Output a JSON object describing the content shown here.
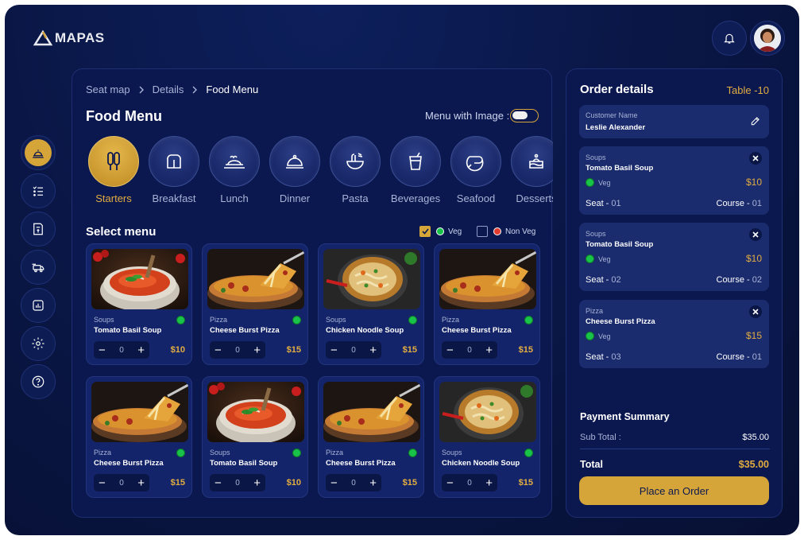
{
  "app": {
    "logo_text": "MAPAS"
  },
  "colors": {
    "accent": "#d6a53a",
    "bg": "#0a1747",
    "veg": "#19c248",
    "non_veg": "#e23b2f"
  },
  "header": {
    "bell_icon": "bell-icon",
    "avatar": "user-avatar"
  },
  "sidebar": {
    "items": [
      "food-bell-icon",
      "checklist-icon",
      "bill-icon",
      "delivery-icon",
      "report-icon",
      "gear-icon",
      "help-icon"
    ]
  },
  "breadcrumb": {
    "items": [
      "Seat map",
      "Details"
    ],
    "current": "Food Menu"
  },
  "menu": {
    "title": "Food Menu",
    "toggle_label": "Menu with Image :",
    "categories": [
      "Starters",
      "Breakfast",
      "Lunch",
      "Dinner",
      "Pasta",
      "Beverages",
      "Seafood",
      "Desserts"
    ],
    "select_title": "Select menu",
    "filter_veg": "Veg",
    "filter_nonveg": "Non Veg",
    "cards": [
      {
        "category": "Soups",
        "name": "Tomato Basil Soup",
        "qty": "0",
        "price": "$10",
        "img": "soup"
      },
      {
        "category": "Pizza",
        "name": "Cheese Burst Pizza",
        "qty": "0",
        "price": "$15",
        "img": "pizza"
      },
      {
        "category": "Soups",
        "name": "Chicken Noodle Soup",
        "qty": "0",
        "price": "$15",
        "img": "noodle"
      },
      {
        "category": "Pizza",
        "name": "Cheese Burst Pizza",
        "qty": "0",
        "price": "$15",
        "img": "pizza"
      },
      {
        "category": "Pizza",
        "name": "Cheese Burst Pizza",
        "qty": "0",
        "price": "$15",
        "img": "pizza"
      },
      {
        "category": "Soups",
        "name": "Tomato Basil Soup",
        "qty": "0",
        "price": "$10",
        "img": "soup"
      },
      {
        "category": "Pizza",
        "name": "Cheese Burst Pizza",
        "qty": "0",
        "price": "$15",
        "img": "pizza"
      },
      {
        "category": "Soups",
        "name": "Chicken Noodle Soup",
        "qty": "0",
        "price": "$15",
        "img": "noodle"
      }
    ],
    "minus": "−",
    "plus": "+"
  },
  "order": {
    "title": "Order details",
    "table": "Table -10",
    "customer_label": "Customer Name",
    "customer_name": "Leslie Alexander",
    "items": [
      {
        "category": "Soups",
        "name": "Tomato Basil Soup",
        "diet": "Veg",
        "price": "$10",
        "seat_label": "Seat -",
        "seat": "01",
        "course_label": "Course -",
        "course": "01"
      },
      {
        "category": "Soups",
        "name": "Tomato Basil Soup",
        "diet": "Veg",
        "price": "$10",
        "seat_label": "Seat -",
        "seat": "02",
        "course_label": "Course -",
        "course": "02"
      },
      {
        "category": "Pizza",
        "name": "Cheese Burst Pizza",
        "diet": "Veg",
        "price": "$15",
        "seat_label": "Seat -",
        "seat": "03",
        "course_label": "Course -",
        "course": "01"
      }
    ],
    "payment_title": "Payment Summary",
    "subtotal_label": "Sub Total :",
    "subtotal": "$35.00",
    "total_label": "Total",
    "total": "$35.00",
    "place_order": "Place an Order"
  }
}
